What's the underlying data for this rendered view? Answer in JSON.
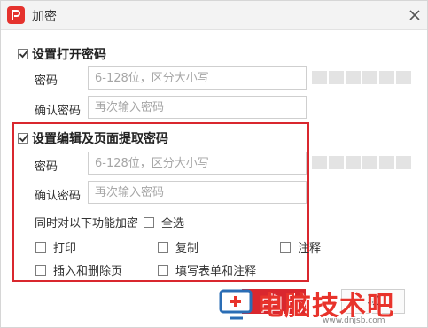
{
  "window": {
    "title": "加密"
  },
  "open_password": {
    "header": "设置打开密码",
    "checked": true,
    "password_label": "密码",
    "password_placeholder": "6-128位，区分大小写",
    "confirm_label": "确认密码",
    "confirm_placeholder": "再次输入密码"
  },
  "edit_password": {
    "header": "设置编辑及页面提取密码",
    "checked": true,
    "password_label": "密码",
    "password_placeholder": "6-128位，区分大小写",
    "confirm_label": "确认密码",
    "confirm_placeholder": "再次输入密码",
    "encrypt_also_label": "同时对以下功能加密",
    "select_all_label": "全选",
    "options": [
      {
        "label": "打印",
        "checked": false
      },
      {
        "label": "复制",
        "checked": false
      },
      {
        "label": "注释",
        "checked": false
      },
      {
        "label": "插入和删除页",
        "checked": false
      },
      {
        "label": "填写表单和注释",
        "checked": false
      }
    ]
  },
  "buttons": {
    "ok_label": "确",
    "cancel_label": "取"
  },
  "watermark": {
    "text": "电脑技术吧",
    "url": "www.dnjsb.com"
  },
  "colors": {
    "accent": "#d9272e",
    "checkmark": "#333333"
  },
  "icons": {
    "app": "pdf-app-icon",
    "close": "close-icon",
    "checkmark": "check-icon"
  }
}
